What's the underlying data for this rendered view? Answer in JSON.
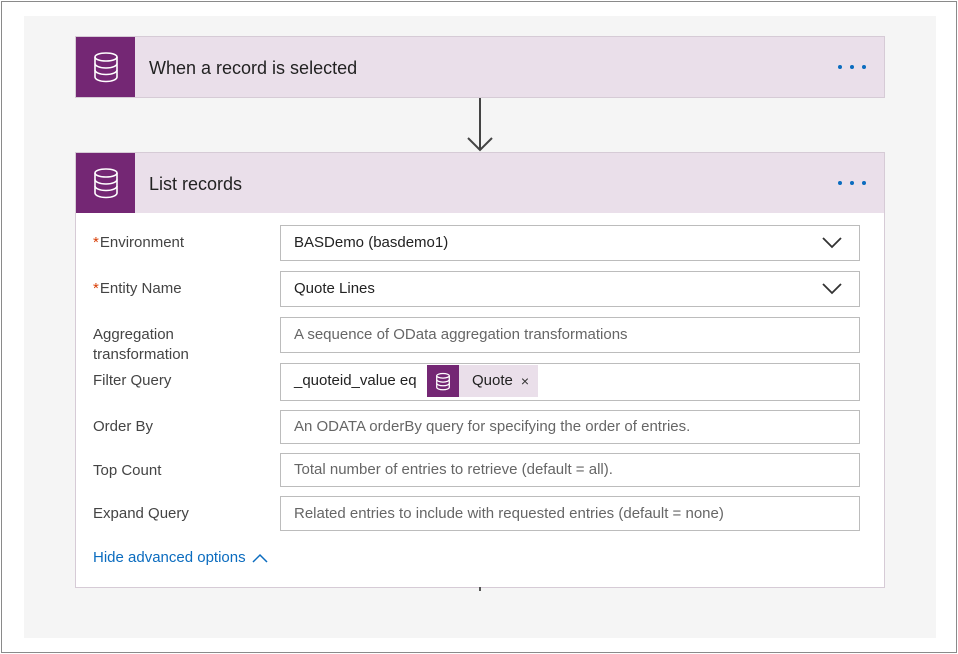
{
  "trigger": {
    "title": "When a record is selected",
    "icon": "database-icon",
    "more_icon": "ellipsis-icon"
  },
  "action": {
    "title": "List records",
    "icon": "database-icon",
    "more_icon": "ellipsis-icon",
    "fields": {
      "environment": {
        "label": "Environment",
        "required": "*",
        "value": "BASDemo (basdemo1)"
      },
      "entity_name": {
        "label": "Entity Name",
        "required": "*",
        "value": "Quote Lines"
      },
      "aggregation": {
        "label_line1": "Aggregation",
        "label_line2": "transformation",
        "placeholder": "A sequence of OData aggregation transformations"
      },
      "filter_query": {
        "label": "Filter Query",
        "value": "_quoteid_value eq",
        "token_label": "Quote",
        "token_remove": "×"
      },
      "order_by": {
        "label": "Order By",
        "placeholder": "An ODATA orderBy query for specifying the order of entries."
      },
      "top_count": {
        "label": "Top Count",
        "placeholder": "Total number of entries to retrieve (default = all)."
      },
      "expand_query": {
        "label": "Expand Query",
        "placeholder": "Related entries to include with requested entries (default = none)"
      }
    },
    "advanced_toggle": "Hide advanced options"
  },
  "colors": {
    "brand": "#742774",
    "header_bg": "#eadfea",
    "link": "#0b6cbf",
    "required": "#d83b01"
  }
}
